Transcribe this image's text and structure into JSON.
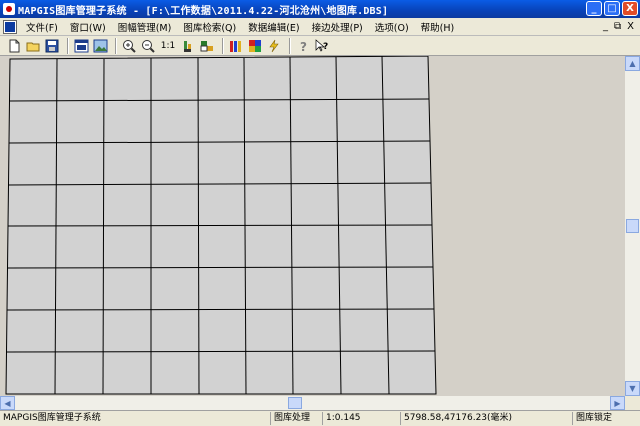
{
  "window": {
    "title": "MAPGIS图库管理子系统 - [F:\\工作数据\\2011.4.22-河北沧州\\地图库.DBS]",
    "buttons": {
      "minimize": "_",
      "maximize": "□",
      "close": "X"
    }
  },
  "menu": {
    "items": [
      "文件(F)",
      "窗口(W)",
      "图幅管理(M)",
      "图库检索(Q)",
      "数据编辑(E)",
      "接边处理(P)",
      "选项(O)",
      "帮助(H)"
    ],
    "mdi_buttons": [
      "_",
      "⧉",
      "X"
    ]
  },
  "toolbar": {
    "zoom_ratio_label": "1:1",
    "icons": [
      "new-file-icon",
      "open-folder-icon",
      "save-icon",
      "window-icon",
      "image-icon",
      "zoom-in-icon",
      "zoom-out-icon",
      "zoom-ratio",
      "sheet-bars-icon",
      "map-sheet-icon",
      "color-bars-icon",
      "palette-icon",
      "lightning-icon",
      "help-icon",
      "context-help-icon"
    ]
  },
  "statusbar": {
    "system_name": "MAPGIS图库管理子系统",
    "mode": "图库处理",
    "scale": "1:0.145",
    "coords": "5798.58,47176.23(毫米)",
    "lock": "图库锁定"
  }
}
